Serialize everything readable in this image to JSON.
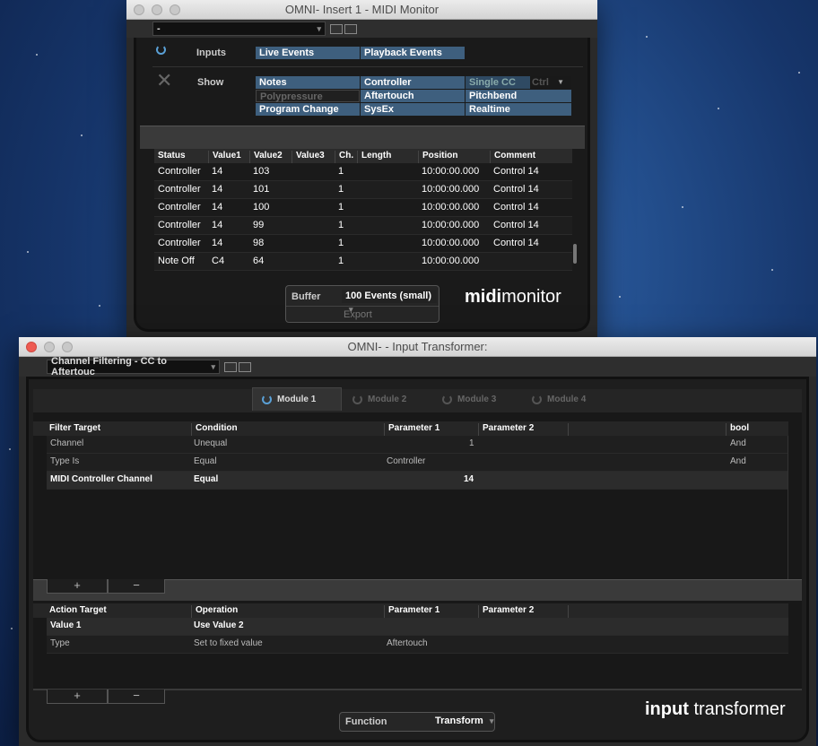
{
  "midi_monitor": {
    "title": "OMNI- Insert 1 - MIDI Monitor",
    "preset": "-",
    "inputs_label": "Inputs",
    "inputs": [
      "Live Events",
      "Playback Events"
    ],
    "show_label": "Show",
    "show": {
      "notes": "Notes",
      "controller": "Controller",
      "single_cc": "Single CC",
      "cc_value": "Ctrl",
      "polypressure": "Polypressure",
      "aftertouch": "Aftertouch",
      "pitchbend": "Pitchbend",
      "program_change": "Program Change",
      "sysex": "SysEx",
      "realtime": "Realtime"
    },
    "columns": [
      "Status",
      "Value1",
      "Value2",
      "Value3",
      "Ch.",
      "Length",
      "Position",
      "Comment"
    ],
    "rows": [
      [
        "Controller",
        "14",
        "103",
        "",
        "1",
        "",
        "10:00:00.000",
        "Control 14"
      ],
      [
        "Controller",
        "14",
        "101",
        "",
        "1",
        "",
        "10:00:00.000",
        "Control 14"
      ],
      [
        "Controller",
        "14",
        "100",
        "",
        "1",
        "",
        "10:00:00.000",
        "Control 14"
      ],
      [
        "Controller",
        "14",
        "99",
        "",
        "1",
        "",
        "10:00:00.000",
        "Control 14"
      ],
      [
        "Controller",
        "14",
        "98",
        "",
        "1",
        "",
        "10:00:00.000",
        "Control 14"
      ],
      [
        "Note Off",
        "C4",
        "64",
        "",
        "1",
        "",
        "10:00:00.000",
        ""
      ]
    ],
    "buffer_label": "Buffer",
    "buffer_value": "100 Events (small)",
    "export_label": "Export",
    "logo_bold": "midi",
    "logo_light": "monitor"
  },
  "input_transformer": {
    "title": "OMNI- - Input Transformer:",
    "preset": "Channel Filtering - CC to Aftertouc",
    "modules": [
      "Module 1",
      "Module 2",
      "Module 3",
      "Module 4"
    ],
    "filter_columns": [
      "Filter Target",
      "Condition",
      "Parameter 1",
      "Parameter 2",
      "bool"
    ],
    "filter_rows": [
      {
        "target": "Channel",
        "condition": "Unequal",
        "p1": "1",
        "p2": "",
        "bool": "And"
      },
      {
        "target": "Type Is",
        "condition": "Equal",
        "p1": "Controller",
        "p2": "",
        "bool": "And"
      },
      {
        "target": "MIDI Controller Channel",
        "condition": "Equal",
        "p1": "14",
        "p2": "",
        "bool": ""
      }
    ],
    "action_columns": [
      "Action Target",
      "Operation",
      "Parameter 1",
      "Parameter 2"
    ],
    "action_rows": [
      {
        "target": "Value 1",
        "operation": "Use Value 2",
        "p1": "",
        "p2": ""
      },
      {
        "target": "Type",
        "operation": "Set to fixed value",
        "p1": "Aftertouch",
        "p2": ""
      }
    ],
    "add": "+",
    "remove": "−",
    "function_label": "Function",
    "function_value": "Transform",
    "logo_bold": "input",
    "logo_light": "transformer"
  }
}
